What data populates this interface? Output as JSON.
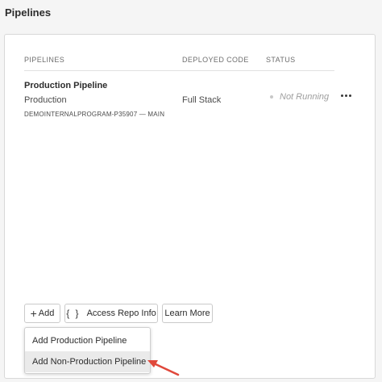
{
  "section": {
    "title": "Pipelines"
  },
  "table": {
    "headers": [
      "PIPELINES",
      "DEPLOYED CODE",
      "STATUS"
    ],
    "rows": [
      {
        "name": "Production Pipeline",
        "environment": "Production",
        "repo": "DEMOINTERNALPROGRAM-P35907 — MAIN",
        "deployed_code": "Full Stack",
        "status": "Not Running",
        "more_icon": "more-horizontal-icon"
      }
    ]
  },
  "actions": {
    "add_label": "Add",
    "add_icon": "plus-icon",
    "repo_label": "Access Repo Info",
    "repo_icon": "code-braces-icon",
    "learn_label": "Learn More"
  },
  "dropdown": {
    "items": [
      "Add Production Pipeline",
      "Add Non-Production Pipeline"
    ],
    "highlighted_index": 1
  },
  "annotation": {
    "arrow_color": "#e0483b"
  },
  "colors": {
    "status_dot": "#c8c8c8",
    "status_text": "#9e9e9e"
  }
}
